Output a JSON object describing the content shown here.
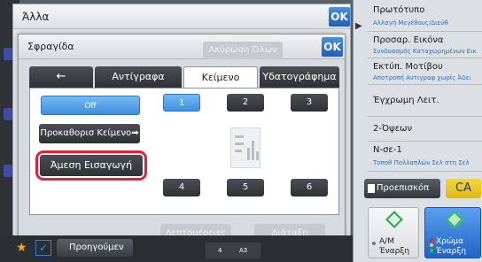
{
  "outer_dialog": {
    "title": "Άλλα",
    "ok_label": "OK"
  },
  "inner_dialog": {
    "title": "Σφραγίδα",
    "ok_label": "OK",
    "clear_all_label": "Ακύρωση Όλων",
    "tabs": {
      "back_glyph": "←",
      "copies": "Αντίγραφα",
      "text": "Κείμενο",
      "watermark": "Υδατογράφημα"
    },
    "selected_tab": "Κείμενο",
    "off_label": "Off",
    "preset_text_label": "Προκαθορισ Κείμενο",
    "preset_arrow": "➡",
    "direct_entry_label": "Άμεση Εισαγωγή",
    "positions": [
      "1",
      "2",
      "3",
      "4",
      "5",
      "6"
    ],
    "selected_position": "1",
    "details_label": "Λεπτομέρειες",
    "layout_label": "Διάταξη"
  },
  "bottom_bar": {
    "star_glyph": "★",
    "check_glyph": "✓",
    "previous_label": "Προηγούμεν",
    "paper_count": "4",
    "paper_size": "A3"
  },
  "right_panel": {
    "arrow_glyph": "▶",
    "items": [
      {
        "title": "Πρωτότυπο",
        "subtitle": "Αλλαγή Μεγέθους/Διεύθ"
      },
      {
        "title": "Προσαρ. Εικόνα",
        "subtitle": "Συνδυασμός Καταχωρημένων Εικ"
      },
      {
        "title": "Εκτύπ. Μοτίβου",
        "subtitle": "Αποτροπή Αντιγραφ χωρίς Άδει"
      },
      {
        "title": "Έγχρωμη Λειτ.",
        "subtitle": ""
      },
      {
        "title": "2-Όψεων",
        "subtitle": ""
      },
      {
        "title": "N-σε-1",
        "subtitle": "Τοποθ Πολλαπλών Σελ στη Σελ"
      }
    ],
    "preview_label": "Προεπισκόπ",
    "ca_label": "CA",
    "bw_start": {
      "line1": "Α/Μ",
      "line2": "Έναρξη"
    },
    "color_start": {
      "line1": "Χρώμα",
      "line2": "Έναρξη"
    }
  },
  "colors": {
    "accent_blue": "#3f8fe0",
    "highlight_red": "#e5203a",
    "ca_yellow": "#f3d63a",
    "star_orange": "#f4a41b",
    "start_green": "#28a745"
  },
  "icons": {
    "back": "arrow-left-icon",
    "star": "star-icon",
    "check": "check-icon",
    "right_arrow": "play-arrow-icon",
    "start": "diamond-start-icon"
  }
}
